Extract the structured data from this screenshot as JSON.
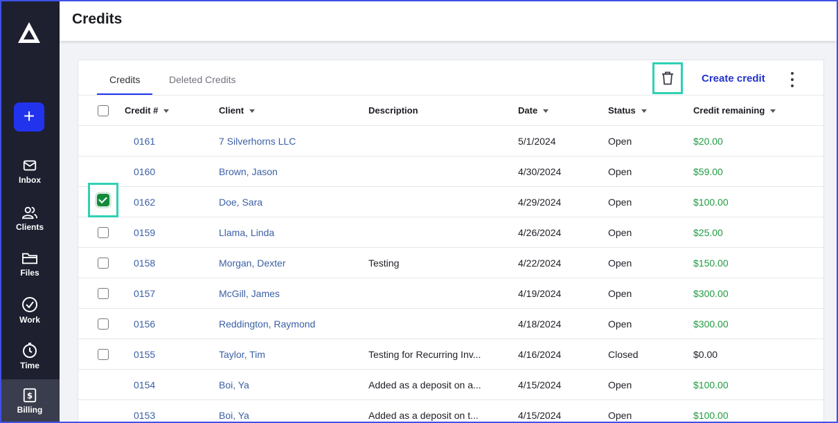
{
  "app": {
    "page_title": "Credits"
  },
  "sidebar": {
    "new_label": "+",
    "items": [
      {
        "label": "Inbox",
        "icon": "mail-icon"
      },
      {
        "label": "Clients",
        "icon": "users-icon"
      },
      {
        "label": "Files",
        "icon": "folder-icon"
      },
      {
        "label": "Work",
        "icon": "check-circle-icon"
      },
      {
        "label": "Time",
        "icon": "timer-icon"
      },
      {
        "label": "Billing",
        "icon": "dollar-icon",
        "active": true
      }
    ]
  },
  "tabs": [
    {
      "label": "Credits",
      "active": true
    },
    {
      "label": "Deleted Credits",
      "active": false
    }
  ],
  "toolbar": {
    "create_label": "Create credit"
  },
  "table": {
    "columns": [
      "Credit #",
      "Client",
      "Description",
      "Date",
      "Status",
      "Credit remaining"
    ],
    "rows": [
      {
        "num": "0161",
        "client": "7 Silverhorns LLC",
        "desc": "",
        "date": "5/1/2024",
        "status": "Open",
        "credit": "$20.00",
        "checkbox": "none"
      },
      {
        "num": "0160",
        "client": "Brown, Jason",
        "desc": "",
        "date": "4/30/2024",
        "status": "Open",
        "credit": "$59.00",
        "checkbox": "none"
      },
      {
        "num": "0162",
        "client": "Doe, Sara",
        "desc": "",
        "date": "4/29/2024",
        "status": "Open",
        "credit": "$100.00",
        "checkbox": "checked"
      },
      {
        "num": "0159",
        "client": "Llama, Linda",
        "desc": "",
        "date": "4/26/2024",
        "status": "Open",
        "credit": "$25.00",
        "checkbox": "unchecked"
      },
      {
        "num": "0158",
        "client": "Morgan, Dexter",
        "desc": "Testing",
        "date": "4/22/2024",
        "status": "Open",
        "credit": "$150.00",
        "checkbox": "unchecked"
      },
      {
        "num": "0157",
        "client": "McGill, James",
        "desc": "",
        "date": "4/19/2024",
        "status": "Open",
        "credit": "$300.00",
        "checkbox": "unchecked"
      },
      {
        "num": "0156",
        "client": "Reddington, Raymond",
        "desc": "",
        "date": "4/18/2024",
        "status": "Open",
        "credit": "$300.00",
        "checkbox": "unchecked"
      },
      {
        "num": "0155",
        "client": "Taylor, Tim",
        "desc": "Testing for Recurring Inv...",
        "date": "4/16/2024",
        "status": "Closed",
        "credit": "$0.00",
        "checkbox": "unchecked"
      },
      {
        "num": "0154",
        "client": "Boi, Ya",
        "desc": "Added as a deposit on a...",
        "date": "4/15/2024",
        "status": "Open",
        "credit": "$100.00",
        "checkbox": "none"
      },
      {
        "num": "0153",
        "client": "Boi, Ya",
        "desc": "Added as a deposit on t...",
        "date": "4/15/2024",
        "status": "Open",
        "credit": "$100.00",
        "checkbox": "none"
      }
    ]
  },
  "colors": {
    "accent": "#2233ee",
    "sidebar_bg": "#1e2030",
    "highlight": "#2ed1b3",
    "credit_green": "#1f9a41",
    "link_blue": "#3b5fa5"
  }
}
